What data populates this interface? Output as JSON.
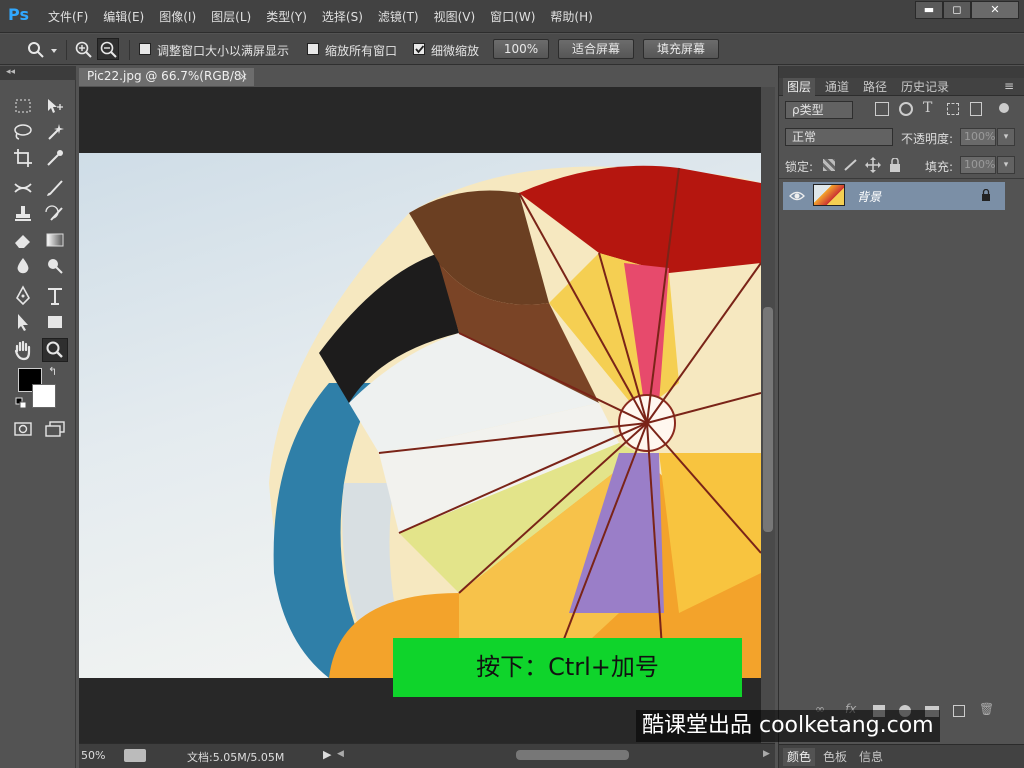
{
  "app": {
    "logo": "Ps"
  },
  "menu": [
    "文件(F)",
    "编辑(E)",
    "图像(I)",
    "图层(L)",
    "类型(Y)",
    "选择(S)",
    "滤镜(T)",
    "视图(V)",
    "窗口(W)",
    "帮助(H)"
  ],
  "window_controls": {
    "minimize": "▬",
    "maximize": "◻",
    "close": "✕"
  },
  "options": {
    "zoom_in_icon": "zoom-in-icon",
    "zoom_out_icon": "zoom-out-icon",
    "resize_windows_label": "调整窗口大小以满屏显示",
    "resize_windows_checked": false,
    "zoom_all_label": "缩放所有窗口",
    "zoom_all_checked": false,
    "scrubby_label": "细微缩放",
    "scrubby_checked": true,
    "btn_100": "100%",
    "btn_fit": "适合屏幕",
    "btn_fill": "填充屏幕"
  },
  "document": {
    "tab_title": "Pic22.jpg @ 66.7%(RGB/8)",
    "tab_close": "×",
    "zoom": "50%",
    "doc_size": "文档:5.05M/5.05M"
  },
  "caption": "按下：Ctrl+加号",
  "layers_panel": {
    "tabs": [
      "图层",
      "通道",
      "路径",
      "历史记录"
    ],
    "filter_label": "ρ类型",
    "blend_mode": "正常",
    "opacity_label": "不透明度:",
    "opacity_value": "100%",
    "lock_label": "锁定:",
    "fill_label": "填充:",
    "fill_value": "100%",
    "layers": [
      {
        "name": "背景",
        "locked": true,
        "visible": true
      }
    ]
  },
  "bottom_tabs": [
    "颜色",
    "色板",
    "信息"
  ],
  "watermark": "酷课堂出品 coolketang.com",
  "colors": {
    "accent": "#31a8ff",
    "caption_bg": "#0fd42b",
    "selected_layer": "#7b8fa6"
  }
}
